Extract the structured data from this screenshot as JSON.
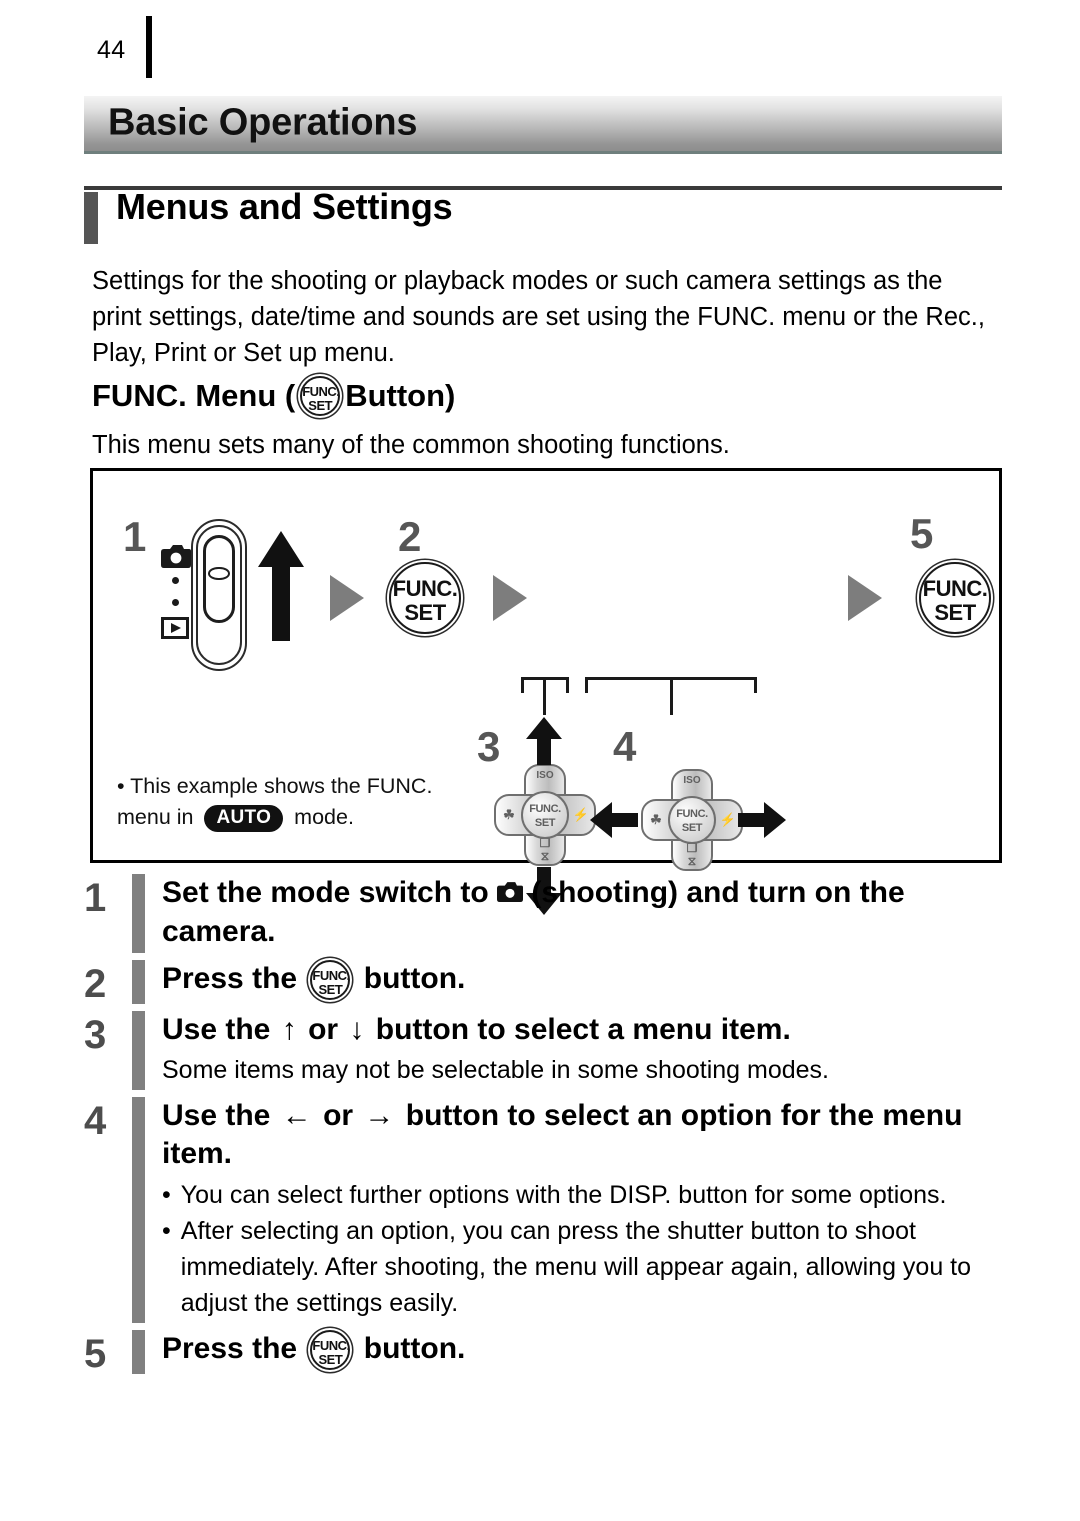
{
  "page": {
    "number": "44"
  },
  "chapter": {
    "title": "Basic Operations"
  },
  "section": {
    "title": "Menus and Settings"
  },
  "intro": {
    "paragraph": "Settings for the shooting or playback modes or such camera settings as the print settings, date/time and sounds are set using the FUNC. menu or the Rec., Play, Print or Set up menu."
  },
  "subsection": {
    "title_before": "FUNC. Menu (",
    "title_after": " Button)",
    "caption": "This menu sets many of the common shooting functions."
  },
  "diagram": {
    "steps": [
      "1",
      "2",
      "3",
      "4",
      "5"
    ],
    "funcset_top": "FUNC.",
    "funcset_bottom": "SET",
    "dpad_labels": {
      "top": "ISO",
      "left": "☘",
      "right": "⚡",
      "bottom_1": "❐",
      "bottom_2": "⧖"
    },
    "note_line_1": "This example shows the FUNC.",
    "note_line_2_before": "menu in",
    "note_badge": "AUTO",
    "note_line_2_after": "mode."
  },
  "instructions": [
    {
      "number": "1",
      "title_part_1": "Set the mode switch to",
      "title_part_2": "(shooting) and turn on the camera.",
      "has_camera_icon": true
    },
    {
      "number": "2",
      "title_part_1": "Press the",
      "title_part_2": "button.",
      "has_funcset_icon": true
    },
    {
      "number": "3",
      "title_part_1": "Use the",
      "arrow_a": "↑",
      "title_part_2": "or",
      "arrow_b": "↓",
      "title_part_3": "button to select a menu item.",
      "sub": "Some items may not be selectable in some shooting modes."
    },
    {
      "number": "4",
      "title_part_1": "Use the",
      "arrow_a": "←",
      "title_part_2": "or",
      "arrow_b": "→",
      "title_part_3": "button to select an option for the menu item.",
      "bullets": [
        "You can select further options with the DISP. button for some options.",
        "After selecting an option, you can press the shutter button to shoot immediately. After shooting, the menu will appear again, allowing you to adjust the settings easily."
      ]
    },
    {
      "number": "5",
      "title_part_1": "Press the",
      "title_part_2": "button.",
      "has_funcset_icon": true
    }
  ],
  "colors": {
    "step_number": "#4d4d4d",
    "step_bar": "#808080",
    "banner_gradient_top": "#f4f4f4",
    "banner_gradient_bottom": "#8e8e8e",
    "banner_underline": "#6f7f7d",
    "arrow_triangle": "#7d7d7d",
    "badge_background": "#111111"
  }
}
